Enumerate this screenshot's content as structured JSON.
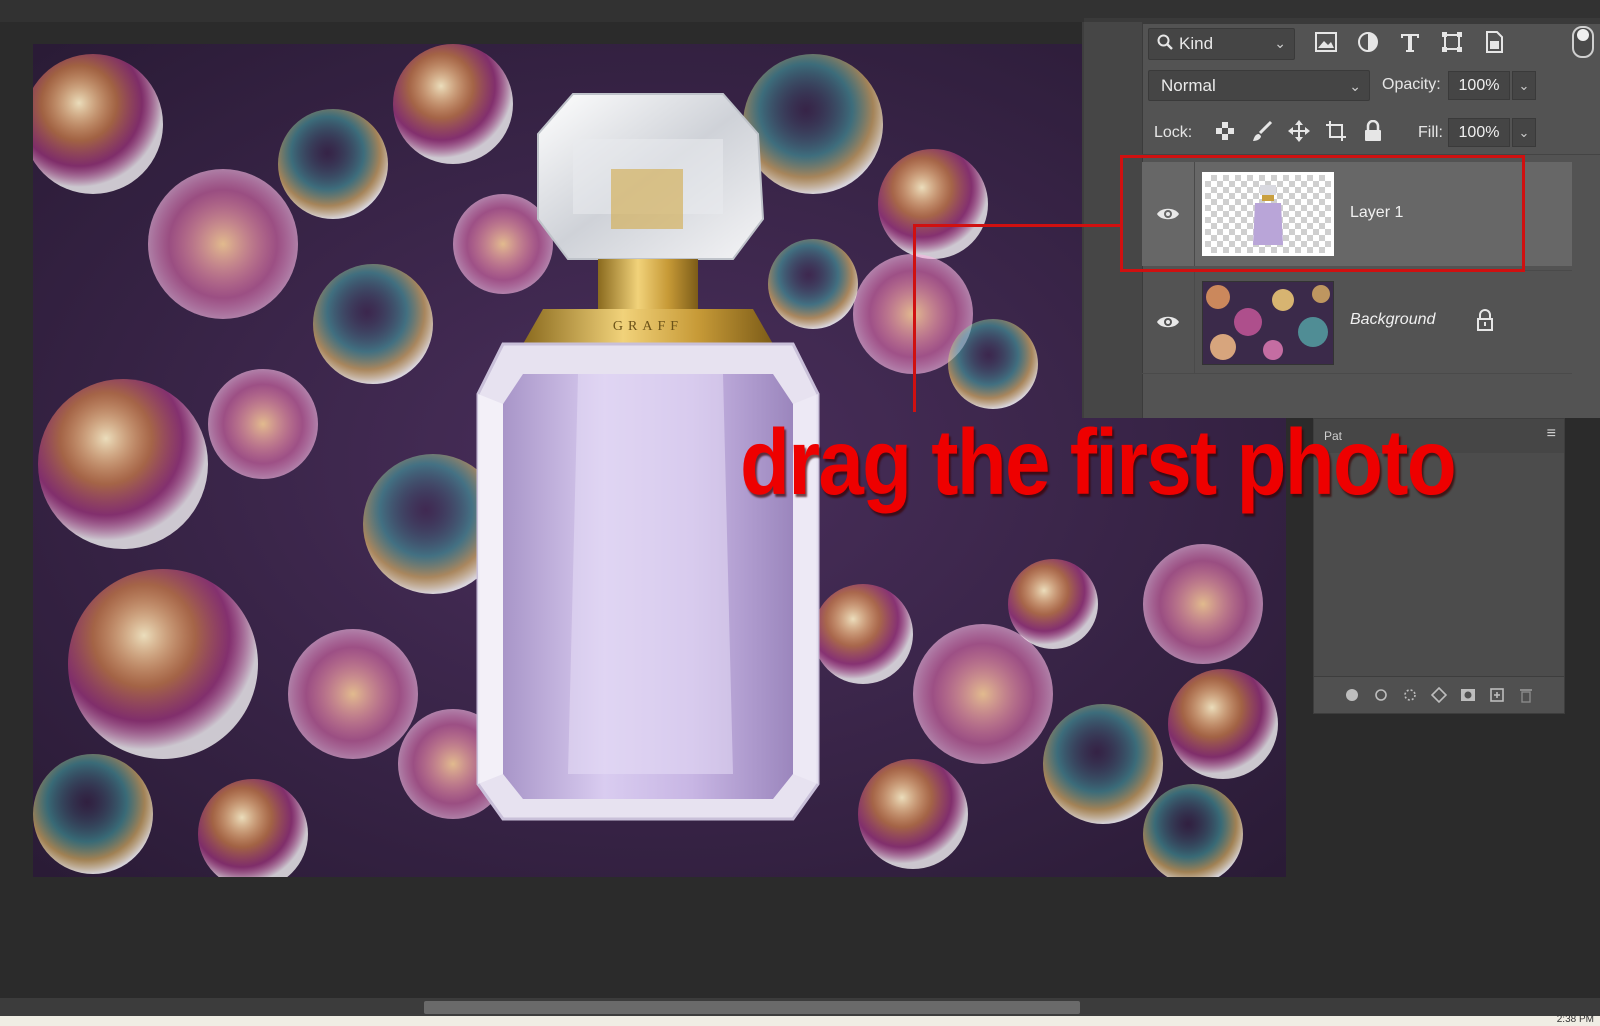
{
  "layers_panel": {
    "filter": {
      "kind_label": "Kind"
    },
    "blend_mode": "Normal",
    "opacity_label": "Opacity:",
    "opacity_value": "100%",
    "lock_label": "Lock:",
    "fill_label": "Fill:",
    "fill_value": "100%",
    "layers": [
      {
        "name": "Layer 1",
        "visible": true,
        "selected": true
      },
      {
        "name": "Background",
        "visible": true,
        "locked": true
      }
    ]
  },
  "paths_panel": {
    "tab_label": "Pat"
  },
  "annotation": {
    "text": "drag the first photo",
    "color": "#ee0000"
  },
  "document": {
    "bottle_brand": "GRAFF"
  },
  "status": {
    "clock": "2:38 PM"
  }
}
